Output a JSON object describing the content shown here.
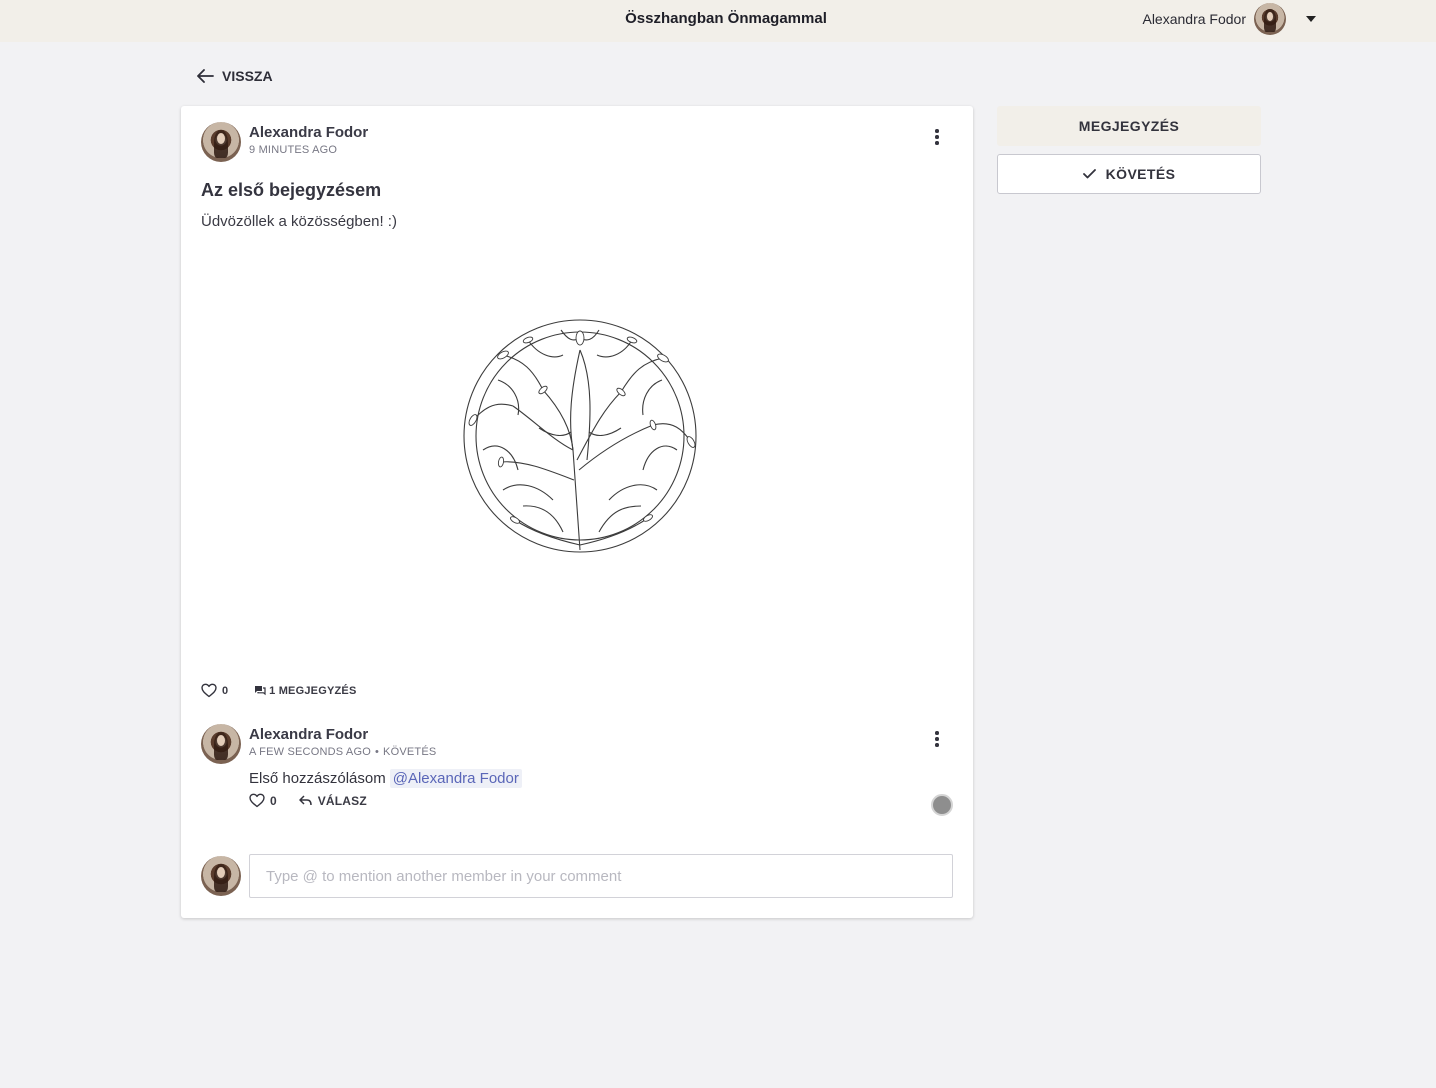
{
  "header": {
    "site_title": "Összhangban Önmagammal",
    "user_name": "Alexandra Fodor"
  },
  "nav": {
    "back_label": "VISSZA"
  },
  "post": {
    "author": "Alexandra Fodor",
    "time": "9 MINUTES AGO",
    "title": "Az első bejegyzésem",
    "body": "Üdvözöllek a közösségben! :)",
    "image_icon": "tree-of-life-illustration",
    "likes": "0",
    "comments_label": "1 MEGJEGYZÉS"
  },
  "comment": {
    "author": "Alexandra Fodor",
    "time": "A FEW SECONDS AGO",
    "separator": "•",
    "follow_label": "KÖVETÉS",
    "text": "Első hozzászólásom",
    "mention": "@Alexandra Fodor",
    "likes": "0",
    "reply_label": "VÁLASZ"
  },
  "composer": {
    "placeholder": "Type @ to mention another member in your comment"
  },
  "sidebar": {
    "comment_button": "MEGJEGYZÉS",
    "follow_button": "KÖVETÉS"
  },
  "colors": {
    "accent_bg": "#f2efe9",
    "page_bg": "#f2f2f4",
    "mention": "#5a66b8"
  }
}
